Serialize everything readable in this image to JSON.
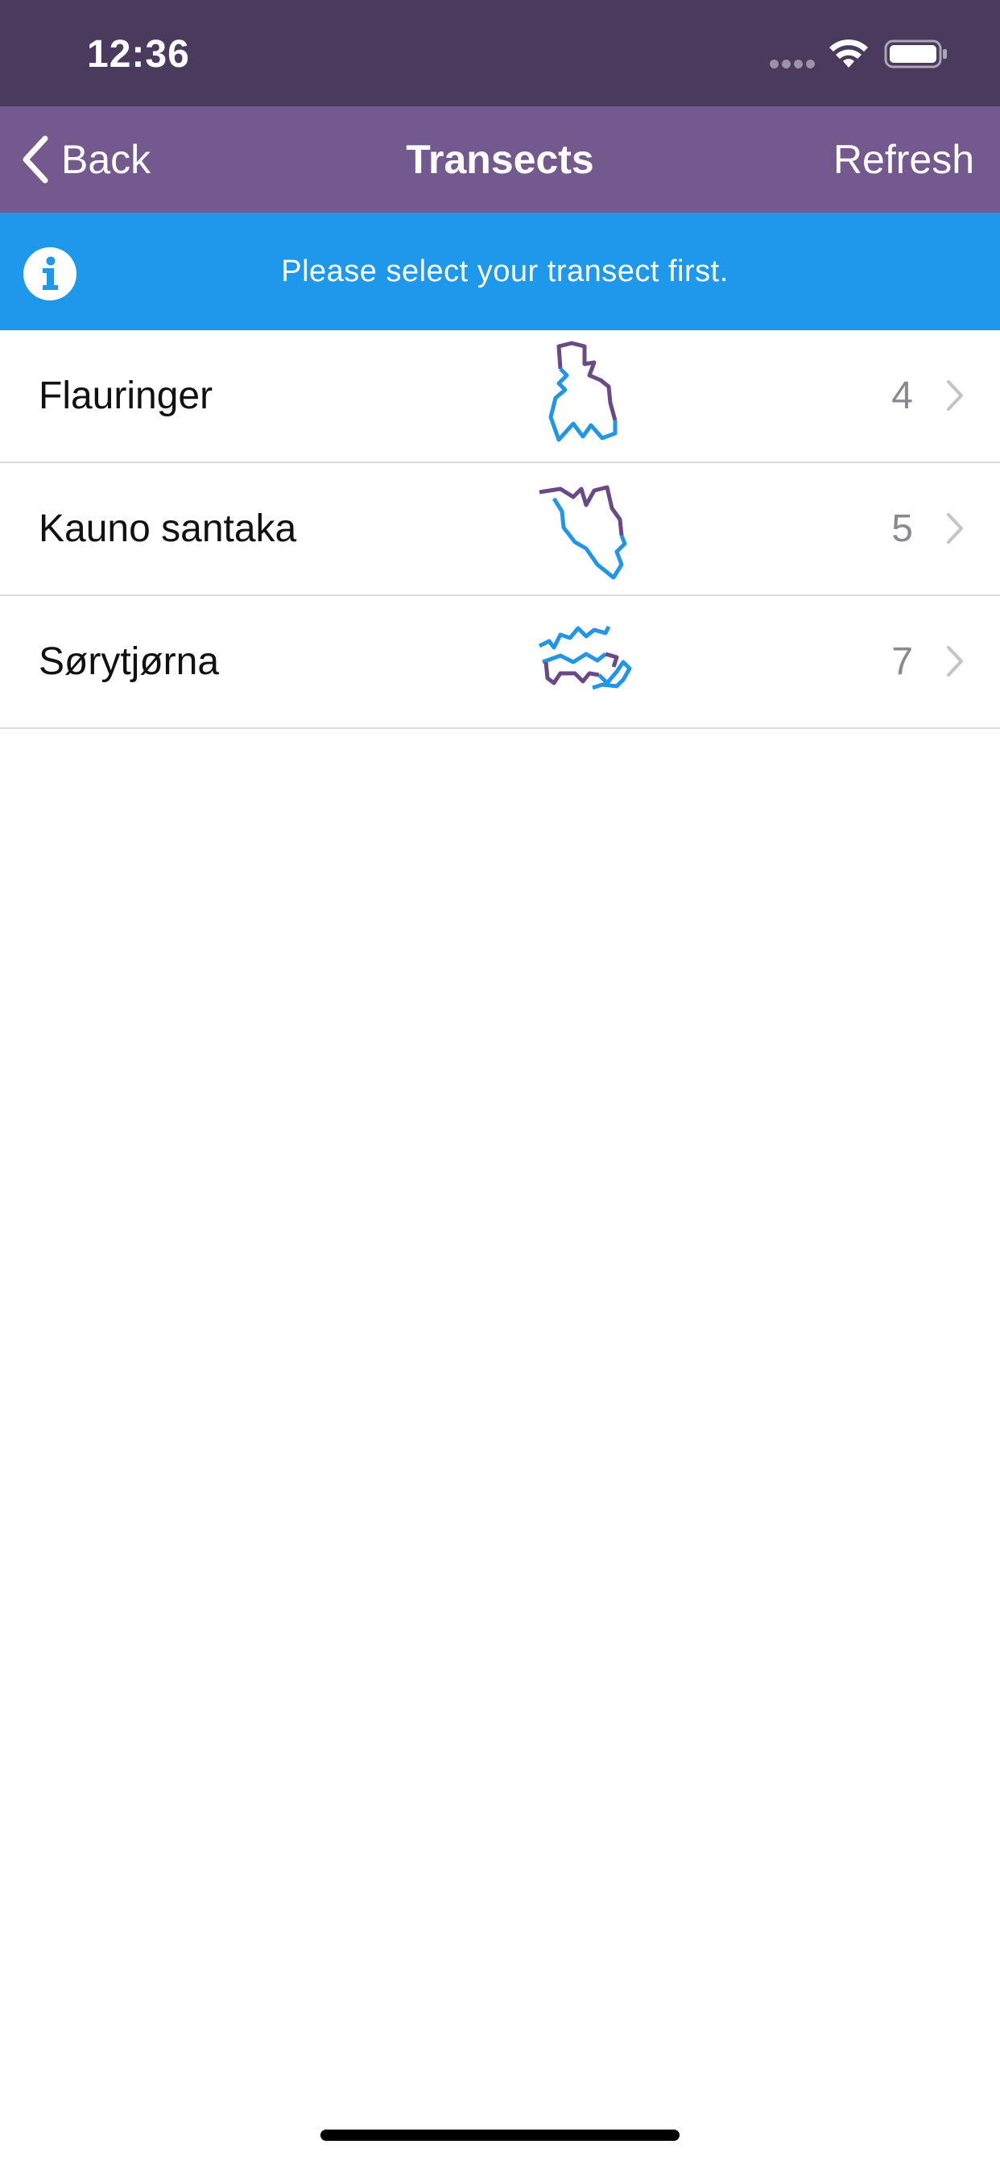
{
  "status_bar": {
    "time": "12:36"
  },
  "nav": {
    "back_label": "Back",
    "title": "Transects",
    "refresh_label": "Refresh"
  },
  "banner": {
    "message": "Please select your transect first."
  },
  "transects": [
    {
      "name": "Flauringer",
      "count": "4"
    },
    {
      "name": "Kauno santaka",
      "count": "5"
    },
    {
      "name": "Sørytjørna",
      "count": "7"
    }
  ],
  "colors": {
    "status_bar": "#4a3a5e",
    "nav_bar": "#74598e",
    "banner": "#1e98eb",
    "route_blue": "#2196e8",
    "route_purple": "#6a4a86"
  },
  "icons": {
    "back": "chevron-left-icon",
    "info": "info-icon",
    "disclosure": "chevron-right-icon",
    "wifi": "wifi-icon",
    "battery": "battery-icon"
  }
}
